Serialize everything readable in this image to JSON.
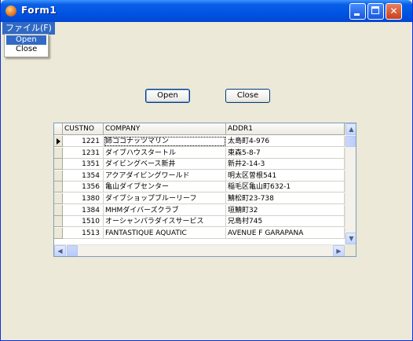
{
  "window": {
    "title": "Form1"
  },
  "menu": {
    "file_label": "ファイル(F)",
    "items": [
      {
        "label": "Open"
      },
      {
        "label": "Close"
      }
    ]
  },
  "buttons": {
    "open_label": "Open",
    "close_label": "Close"
  },
  "grid": {
    "columns": [
      "CUSTNO",
      "COMPANY",
      "ADDR1"
    ],
    "rows": [
      {
        "custno": "1221",
        "company": "姉ココナッツマリン",
        "addr1": "太島町4-976"
      },
      {
        "custno": "1231",
        "company": "ダイブハウスタートル",
        "addr1": "東森5-8-7"
      },
      {
        "custno": "1351",
        "company": "ダイビングベース新井",
        "addr1": "新井2-14-3"
      },
      {
        "custno": "1354",
        "company": "アクアダイビングワールド",
        "addr1": "明太区曽根541"
      },
      {
        "custno": "1356",
        "company": "亀山ダイブセンター",
        "addr1": "稲毛区亀山町632-1"
      },
      {
        "custno": "1380",
        "company": "ダイブショップブルーリーフ",
        "addr1": "鯖松町23-738"
      },
      {
        "custno": "1384",
        "company": "MHMダイバーズクラブ",
        "addr1": "垣鯖町32"
      },
      {
        "custno": "1510",
        "company": "オーシャンパラダイスサービス",
        "addr1": "兄島村745"
      },
      {
        "custno": "1513",
        "company": "FANTASTIQUE AQUATIC",
        "addr1": "AVENUE F GARAPANA"
      }
    ],
    "current_row": 0
  },
  "colors": {
    "titlebar": "#0054e3",
    "selection": "#316ac5",
    "face": "#ece9d8"
  }
}
